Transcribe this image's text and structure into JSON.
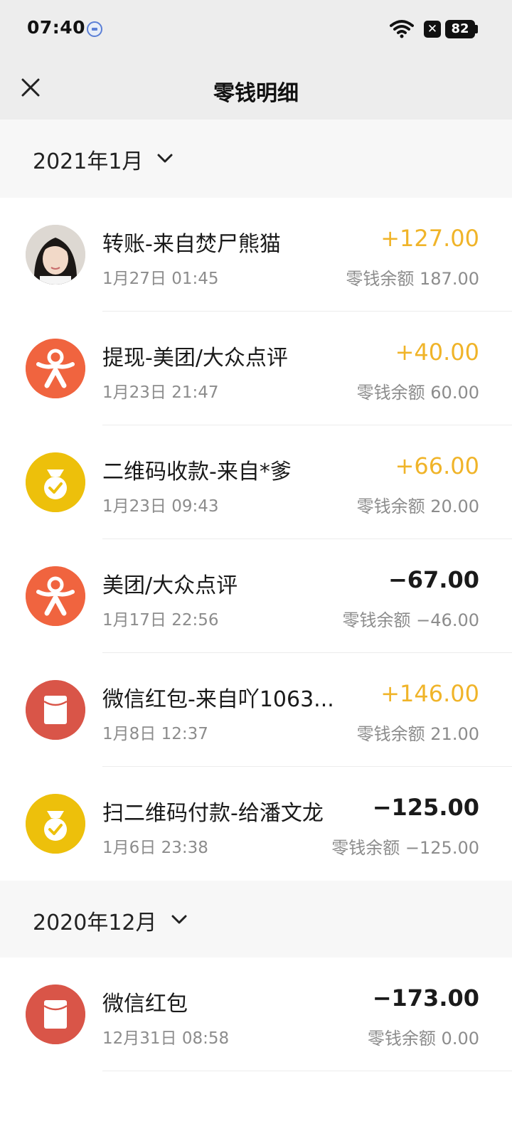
{
  "status_bar": {
    "time": "07:40",
    "battery": "82"
  },
  "nav": {
    "title": "零钱明细"
  },
  "sections": [
    {
      "month": "2021年1月",
      "transactions": [
        {
          "title": "转账-来自焚尸熊猫",
          "time": "1月27日 01:45",
          "amount": "+127.00",
          "balance": "零钱余额 187.00",
          "icon": "user-photo-avatar"
        },
        {
          "title": "提现-美团/大众点评",
          "time": "1月23日 21:47",
          "amount": "+40.00",
          "balance": "零钱余额 60.00",
          "icon": "meituan-icon"
        },
        {
          "title": "二维码收款-来自*爹",
          "time": "1月23日 09:43",
          "amount": "+66.00",
          "balance": "零钱余额 20.00",
          "icon": "qr-money-bag-icon"
        },
        {
          "title": "美团/大众点评",
          "time": "1月17日 22:56",
          "amount": "−67.00",
          "balance": "零钱余额 −46.00",
          "icon": "meituan-icon"
        },
        {
          "title": "微信红包-来自吖1063...",
          "time": "1月8日 12:37",
          "amount": "+146.00",
          "balance": "零钱余额 21.00",
          "icon": "red-packet-icon"
        },
        {
          "title": "扫二维码付款-给潘文龙",
          "time": "1月6日 23:38",
          "amount": "−125.00",
          "balance": "零钱余额 −125.00",
          "icon": "qr-money-bag-icon"
        }
      ]
    },
    {
      "month": "2020年12月",
      "transactions": [
        {
          "title": "微信红包",
          "time": "12月31日 08:58",
          "amount": "−173.00",
          "balance": "零钱余额 0.00",
          "icon": "red-packet-icon"
        }
      ]
    }
  ],
  "colors": {
    "income": "#f0b429",
    "expense": "#1a1a1a",
    "header_bg": "#ededed",
    "section_bg": "#f7f7f7"
  }
}
